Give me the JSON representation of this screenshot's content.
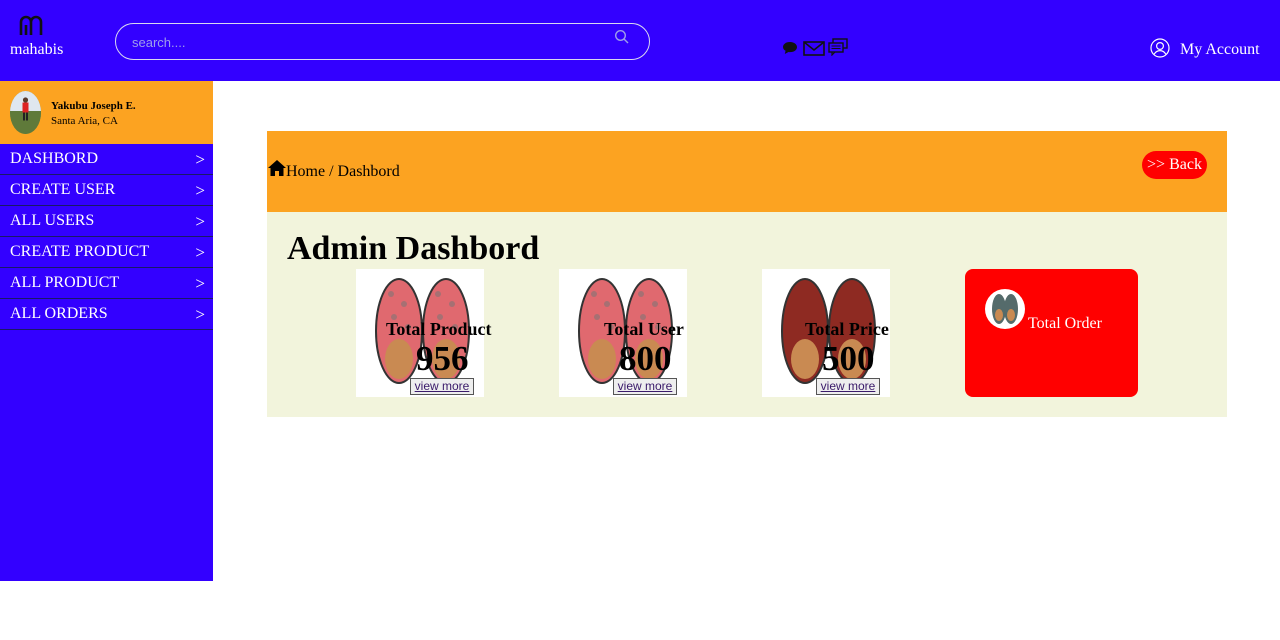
{
  "header": {
    "brand": "mahabis",
    "search_placeholder": "search....",
    "account_label": "My Account",
    "icons": [
      "chat-bubble-icon",
      "mail-icon",
      "messages-icon",
      "user-circle-icon"
    ]
  },
  "sidebar": {
    "profile": {
      "name": "Yakubu Joseph E.",
      "location": "Santa Aria, CA"
    },
    "items": [
      {
        "label": "DASHBORD",
        "arrow": ">"
      },
      {
        "label": "CREATE USER",
        "arrow": ">"
      },
      {
        "label": "ALL USERS",
        "arrow": ">"
      },
      {
        "label": "CREATE PRODUCT",
        "arrow": ">"
      },
      {
        "label": "ALL PRODUCT",
        "arrow": ">"
      },
      {
        "label": "ALL ORDERS",
        "arrow": ">"
      }
    ]
  },
  "breadcrumb": {
    "text": "Home / Dashbord",
    "back_label": ">> Back"
  },
  "dashboard": {
    "title": "Admin Dashbord",
    "cards": [
      {
        "label": "Total Product",
        "value": "956",
        "button": "view more"
      },
      {
        "label": "Total User",
        "value": "800",
        "button": "view more"
      },
      {
        "label": "Total Price",
        "value": "500",
        "button": "view more"
      }
    ],
    "order_card": {
      "label": "Total Order"
    }
  },
  "colors": {
    "primary": "#3300ff",
    "accent": "#fca321",
    "danger": "#ff0000",
    "panel": "#f2f4dc"
  }
}
